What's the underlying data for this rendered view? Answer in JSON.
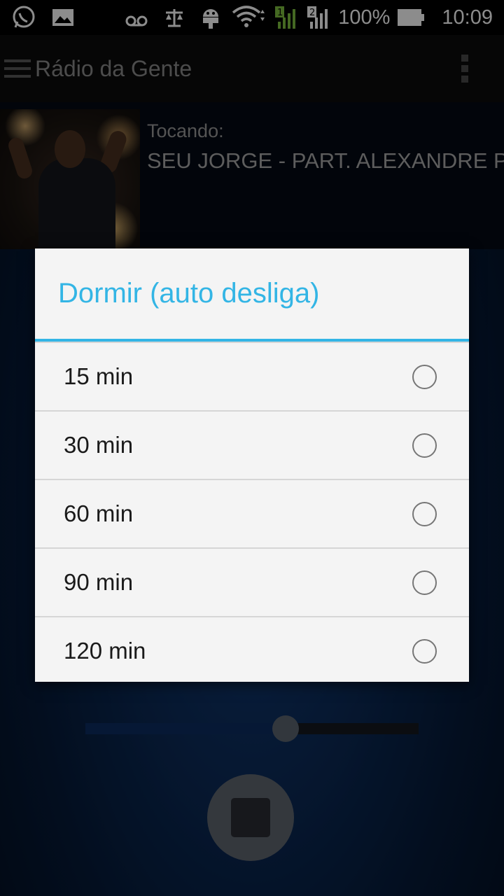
{
  "status_bar": {
    "icons": [
      "whatsapp-icon",
      "gallery-icon",
      "voicemail-icon",
      "scale-icon",
      "android-icon",
      "wifi-icon",
      "sim1-signal-icon",
      "sim2-signal-icon",
      "battery-icon"
    ],
    "battery": "100%",
    "time": "10:09"
  },
  "toolbar": {
    "title": "Rádio da Gente"
  },
  "now_playing": {
    "label": "Tocando:",
    "track": "SEU JORGE - PART. ALEXANDRE P"
  },
  "dialog": {
    "title": "Dormir (auto desliga)",
    "options": [
      {
        "label": "15 min",
        "selected": false
      },
      {
        "label": "30 min",
        "selected": false
      },
      {
        "label": "60 min",
        "selected": false
      },
      {
        "label": "90 min",
        "selected": false
      },
      {
        "label": "120 min",
        "selected": false
      }
    ]
  },
  "player": {
    "volume": 0.6
  },
  "colors": {
    "accent": "#33b5e5",
    "dialog_bg": "#f4f4f4",
    "toolbar_bg": "#0c0c0c"
  }
}
